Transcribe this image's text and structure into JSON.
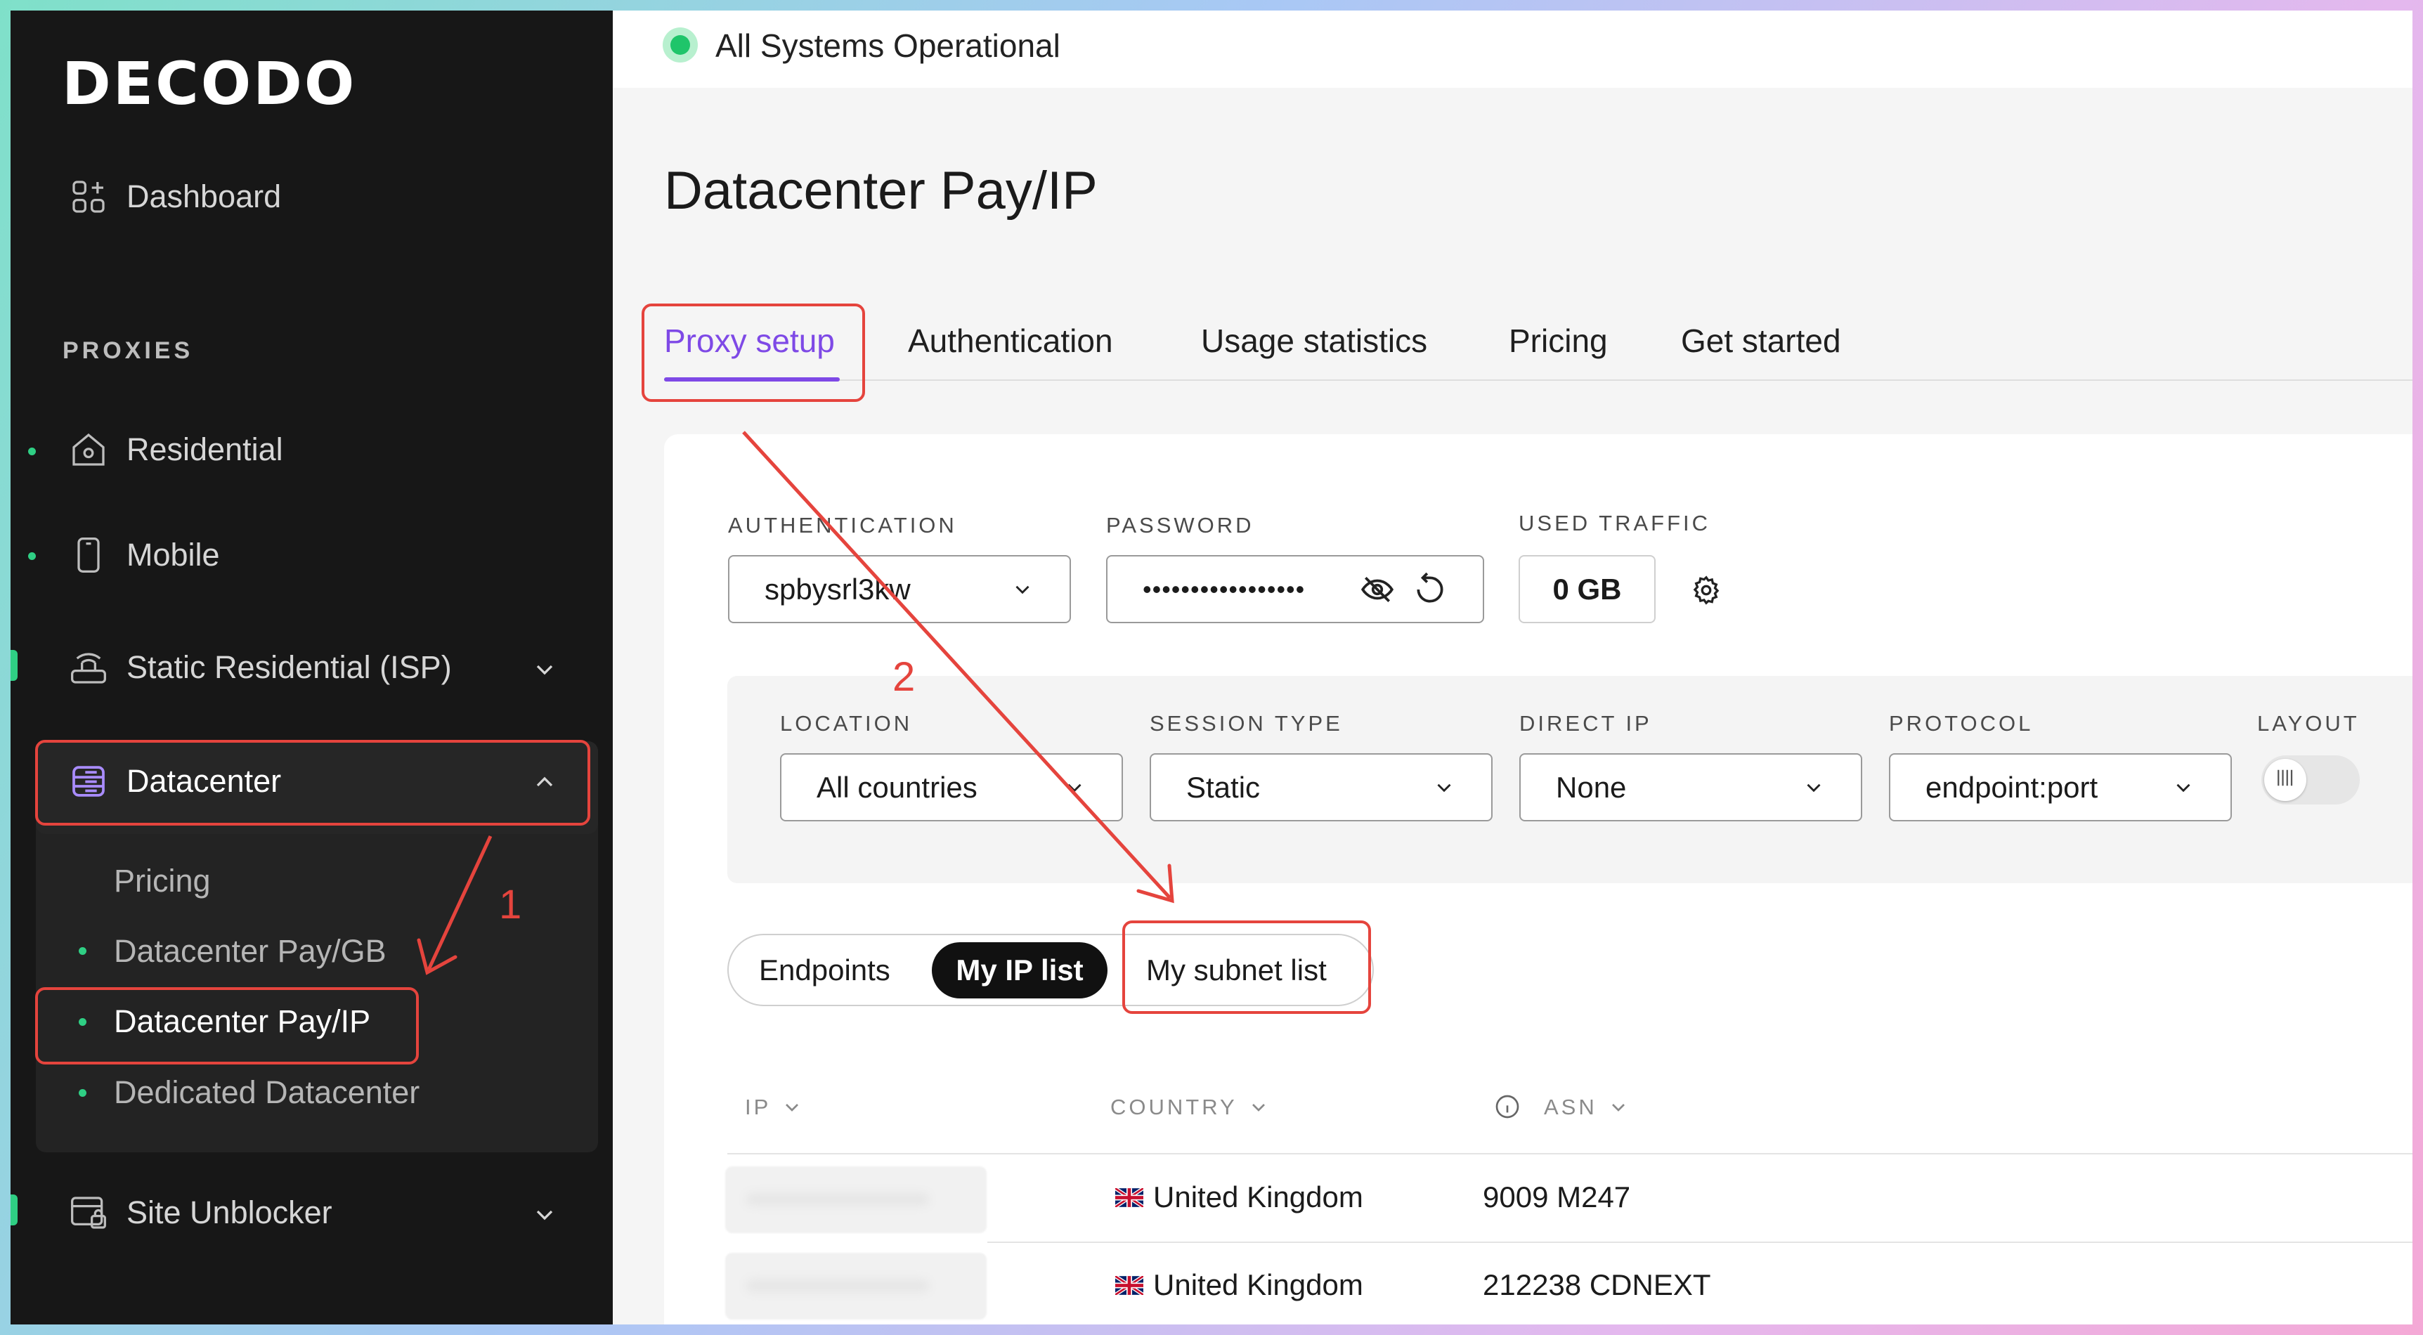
{
  "brand": {
    "logo_text": "DECODO"
  },
  "sidebar": {
    "dashboard": "Dashboard",
    "section_proxies": "PROXIES",
    "items": {
      "residential": "Residential",
      "mobile": "Mobile",
      "static_isp": "Static Residential (ISP)",
      "datacenter": "Datacenter",
      "site_unblocker": "Site Unblocker"
    },
    "datacenter_sub": {
      "pricing": "Pricing",
      "pay_gb": "Datacenter Pay/GB",
      "pay_ip": "Datacenter Pay/IP",
      "dedicated": "Dedicated Datacenter"
    }
  },
  "status": {
    "text": "All Systems Operational",
    "color": "#1fc56a"
  },
  "page": {
    "title": "Datacenter Pay/IP"
  },
  "tabs": {
    "proxy_setup": "Proxy setup",
    "authentication": "Authentication",
    "usage_statistics": "Usage statistics",
    "pricing": "Pricing",
    "get_started": "Get started"
  },
  "auth_section": {
    "authentication_label": "AUTHENTICATION",
    "authentication_value": "spbysrl3kw",
    "password_label": "PASSWORD",
    "password_value": "•••••••••••••••••",
    "used_traffic_label": "USED TRAFFIC",
    "used_traffic_value": "0 GB"
  },
  "filters": {
    "location_label": "LOCATION",
    "location_value": "All countries",
    "session_label": "SESSION TYPE",
    "session_value": "Static",
    "direct_ip_label": "DIRECT IP",
    "direct_ip_value": "None",
    "protocol_label": "PROTOCOL",
    "protocol_value": "endpoint:port",
    "layout_label": "LAYOUT"
  },
  "segments": {
    "endpoints": "Endpoints",
    "my_ip_list": "My IP list",
    "my_subnet_list": "My subnet list"
  },
  "table": {
    "headers": {
      "ip": "IP",
      "country": "COUNTRY",
      "asn": "ASN"
    },
    "rows": [
      {
        "country": "United Kingdom",
        "asn": "9009 M247"
      },
      {
        "country": "United Kingdom",
        "asn": "212238 CDNEXT"
      }
    ]
  },
  "annotations": {
    "step1": "1",
    "step2": "2",
    "color": "#e5443d"
  },
  "colors": {
    "accent": "#7e49e6",
    "sidebar_bg": "#171717",
    "green": "#2fcf84"
  }
}
